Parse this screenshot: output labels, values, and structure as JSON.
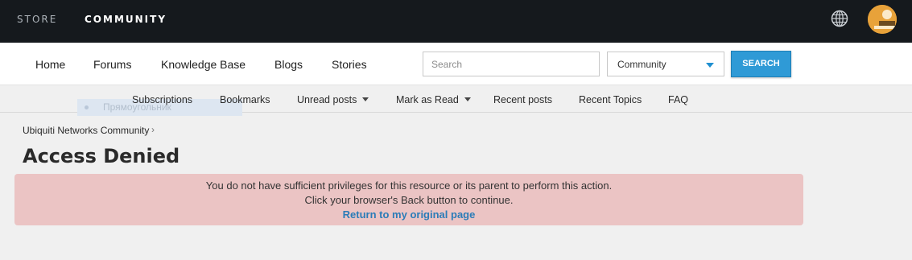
{
  "topnav": {
    "store": "STORE",
    "community": "COMMUNITY"
  },
  "icons": {
    "globe": "globe-icon",
    "avatar": "avatar"
  },
  "mainnav": {
    "links": [
      "Home",
      "Forums",
      "Knowledge Base",
      "Blogs",
      "Stories"
    ],
    "search_placeholder": "Search",
    "scope": "Community",
    "search_button": "SEARCH"
  },
  "subnav": {
    "links": [
      "Subscriptions",
      "Bookmarks",
      "Unread posts",
      "Mark as Read",
      "Recent posts",
      "Recent Topics",
      "FAQ"
    ],
    "ghost_text": "Прямоугольник"
  },
  "breadcrumb": "Ubiquiti Networks Community",
  "page_title": "Access Denied",
  "alert": {
    "line1": "You do not have sufficient privileges for this resource or its parent to perform this action.",
    "line2": "Click your browser's Back button to continue.",
    "link": "Return to my original page",
    "bg_color": "#ebc4c4"
  },
  "colors": {
    "topbar": "#15191d",
    "accent": "#2f9ad6"
  }
}
